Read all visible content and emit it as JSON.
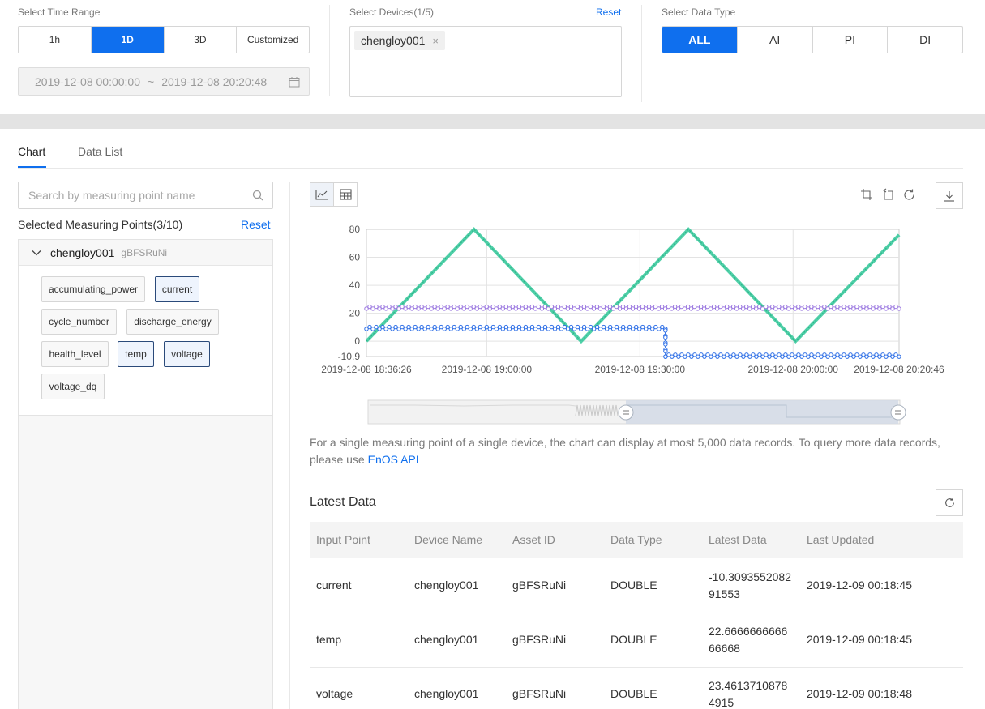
{
  "time_range": {
    "label": "Select Time Range",
    "options": [
      "1h",
      "1D",
      "3D",
      "Customized"
    ],
    "active": "1D",
    "start": "2019-12-08 00:00:00",
    "separator": "~",
    "end": "2019-12-08 20:20:48"
  },
  "devices": {
    "label": "Select Devices(1/5)",
    "reset": "Reset",
    "selected": [
      "chengloy001"
    ]
  },
  "data_type": {
    "label": "Select Data Type",
    "options": [
      "ALL",
      "AI",
      "PI",
      "DI"
    ],
    "active": "ALL"
  },
  "tabs": [
    "Chart",
    "Data List"
  ],
  "active_tab": "Chart",
  "left": {
    "search_placeholder": "Search by measuring point name",
    "selected_label": "Selected Measuring Points(3/10)",
    "reset": "Reset",
    "device_name": "chengloy001",
    "asset_id": "gBFSRuNi",
    "points": [
      {
        "name": "accumulating_power",
        "selected": false
      },
      {
        "name": "current",
        "selected": true
      },
      {
        "name": "cycle_number",
        "selected": false
      },
      {
        "name": "discharge_energy",
        "selected": false
      },
      {
        "name": "health_level",
        "selected": false
      },
      {
        "name": "temp",
        "selected": true
      },
      {
        "name": "voltage",
        "selected": true
      },
      {
        "name": "voltage_dq",
        "selected": false
      }
    ]
  },
  "chart_data": {
    "type": "line",
    "title": "",
    "xlabel": "",
    "ylabel": "",
    "y_ticks": [
      80,
      60,
      40,
      20,
      0,
      -10.9
    ],
    "ylim": [
      -10.9,
      80
    ],
    "x_tick_labels": [
      "2019-12-08 18:36:26",
      "2019-12-08 19:00:00",
      "2019-12-08 19:30:00",
      "2019-12-08 20:00:00",
      "2019-12-08 20:20:46"
    ],
    "x_range": [
      "2019-12-08 18:36:26",
      "2019-12-08 20:20:46"
    ],
    "grid": true,
    "series": [
      {
        "color": "#4fd0a8",
        "x": [
          "18:36:26",
          "18:57:30",
          "19:18:30",
          "19:39:30",
          "20:00:30",
          "20:20:46"
        ],
        "y": [
          0,
          80,
          0,
          80,
          0,
          76
        ]
      },
      {
        "color": "#9b78e0",
        "x": [
          "18:36:26",
          "20:20:46"
        ],
        "y": [
          24,
          24
        ]
      },
      {
        "color": "#2e6fe6",
        "x": [
          "18:36:26",
          "19:35:00",
          "19:35:01",
          "20:20:46"
        ],
        "y": [
          9.5,
          9.5,
          -10.3,
          -10.3
        ]
      }
    ]
  },
  "notice": {
    "text": "For a single measuring point of a single device, the chart can display at most 5,000 data records. To query more data records, please use",
    "link": "EnOS API"
  },
  "latest": {
    "title": "Latest Data",
    "columns": [
      "Input Point",
      "Device Name",
      "Asset ID",
      "Data Type",
      "Latest Data",
      "Last Updated"
    ],
    "rows": [
      {
        "point": "current",
        "device": "chengloy001",
        "asset": "gBFSRuNi",
        "type": "DOUBLE",
        "value_l1": "-10.3093552082",
        "value_l2": "91553",
        "updated": "2019-12-09 00:18:45"
      },
      {
        "point": "temp",
        "device": "chengloy001",
        "asset": "gBFSRuNi",
        "type": "DOUBLE",
        "value_l1": "22.6666666666",
        "value_l2": "66668",
        "updated": "2019-12-09 00:18:45"
      },
      {
        "point": "voltage",
        "device": "chengloy001",
        "asset": "gBFSRuNi",
        "type": "DOUBLE",
        "value_l1": "23.4613710878",
        "value_l2": "4915",
        "updated": "2019-12-09 00:18:48"
      }
    ]
  }
}
